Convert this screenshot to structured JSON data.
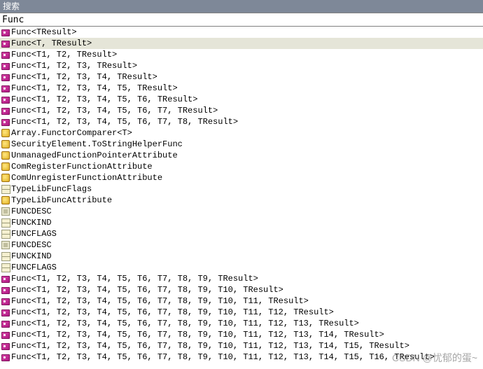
{
  "titlebar": {
    "label": "搜索"
  },
  "search": {
    "value": "Func"
  },
  "selected_index": 1,
  "items": [
    {
      "icon": "delegate",
      "label": "Func<TResult>"
    },
    {
      "icon": "delegate",
      "label": "Func<T, TResult>"
    },
    {
      "icon": "delegate",
      "label": "Func<T1, T2, TResult>"
    },
    {
      "icon": "delegate",
      "label": "Func<T1, T2, T3, TResult>"
    },
    {
      "icon": "delegate",
      "label": "Func<T1, T2, T3, T4, TResult>"
    },
    {
      "icon": "delegate",
      "label": "Func<T1, T2, T3, T4, T5, TResult>"
    },
    {
      "icon": "delegate",
      "label": "Func<T1, T2, T3, T4, T5, T6, TResult>"
    },
    {
      "icon": "delegate",
      "label": "Func<T1, T2, T3, T4, T5, T6, T7, TResult>"
    },
    {
      "icon": "delegate",
      "label": "Func<T1, T2, T3, T4, T5, T6, T7, T8, TResult>"
    },
    {
      "icon": "class",
      "label": "Array.FunctorComparer<T>"
    },
    {
      "icon": "class",
      "label": "SecurityElement.ToStringHelperFunc"
    },
    {
      "icon": "class",
      "label": "UnmanagedFunctionPointerAttribute"
    },
    {
      "icon": "class",
      "label": "ComRegisterFunctionAttribute"
    },
    {
      "icon": "class",
      "label": "ComUnregisterFunctionAttribute"
    },
    {
      "icon": "enum",
      "label": "TypeLibFuncFlags"
    },
    {
      "icon": "class",
      "label": "TypeLibFuncAttribute"
    },
    {
      "icon": "struct",
      "label": "FUNCDESC"
    },
    {
      "icon": "enum",
      "label": "FUNCKIND"
    },
    {
      "icon": "enum",
      "label": "FUNCFLAGS"
    },
    {
      "icon": "struct",
      "label": "FUNCDESC"
    },
    {
      "icon": "enum",
      "label": "FUNCKIND"
    },
    {
      "icon": "enum",
      "label": "FUNCFLAGS"
    },
    {
      "icon": "delegate",
      "label": "Func<T1, T2, T3, T4, T5, T6, T7, T8, T9, TResult>"
    },
    {
      "icon": "delegate",
      "label": "Func<T1, T2, T3, T4, T5, T6, T7, T8, T9, T10, TResult>"
    },
    {
      "icon": "delegate",
      "label": "Func<T1, T2, T3, T4, T5, T6, T7, T8, T9, T10, T11, TResult>"
    },
    {
      "icon": "delegate",
      "label": "Func<T1, T2, T3, T4, T5, T6, T7, T8, T9, T10, T11, T12, TResult>"
    },
    {
      "icon": "delegate",
      "label": "Func<T1, T2, T3, T4, T5, T6, T7, T8, T9, T10, T11, T12, T13, TResult>"
    },
    {
      "icon": "delegate",
      "label": "Func<T1, T2, T3, T4, T5, T6, T7, T8, T9, T10, T11, T12, T13, T14, TResult>"
    },
    {
      "icon": "delegate",
      "label": "Func<T1, T2, T3, T4, T5, T6, T7, T8, T9, T10, T11, T12, T13, T14, T15, TResult>"
    },
    {
      "icon": "delegate",
      "label": "Func<T1, T2, T3, T4, T5, T6, T7, T8, T9, T10, T11, T12, T13, T14, T15, T16, TResult>"
    }
  ],
  "watermark": "CSDN @忧郁的蛋~"
}
